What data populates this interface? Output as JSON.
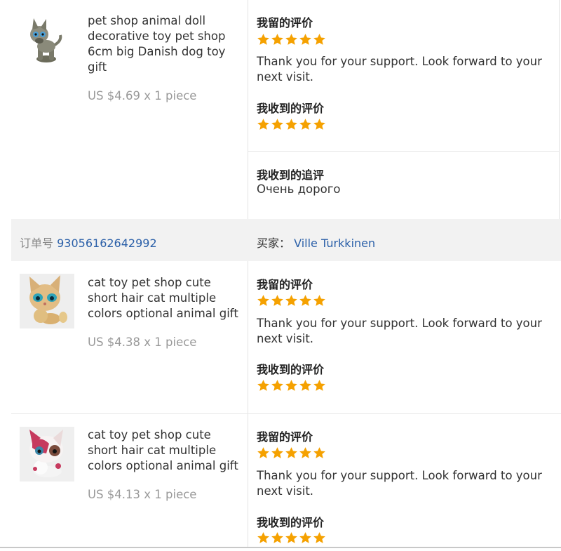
{
  "block1": {
    "title": "pet shop animal doll decorative toy pet shop 6cm big Danish dog toy gift",
    "price": "US $4.69 x 1 piece",
    "feedback_left_label": "我留的评价",
    "feedback_left_rating": 5,
    "feedback_left_message": "Thank you for your support. Look forward to your next visit.",
    "feedback_received_label": "我收到的评价",
    "feedback_received_rating": 5,
    "followup_label": "我收到的追评",
    "followup_text": "Очень дорого"
  },
  "order_bar": {
    "order_label": "订单号",
    "order_number": "93056162642992",
    "buyer_label": "买家：",
    "buyer_name": "Ville Turkkinen"
  },
  "block2": {
    "title": "cat toy pet shop cute short hair cat multiple colors optional animal gift",
    "price": "US $4.38 x 1 piece",
    "feedback_left_label": "我留的评价",
    "feedback_left_rating": 5,
    "feedback_left_message": "Thank you for your support. Look forward to your next visit.",
    "feedback_received_label": "我收到的评价",
    "feedback_received_rating": 5
  },
  "block3": {
    "title": "cat toy pet shop cute short hair cat multiple colors optional animal gift",
    "price": "US $4.13 x 1 piece",
    "feedback_left_label": "我留的评价",
    "feedback_left_rating": 5,
    "feedback_left_message": "Thank you for your support. Look forward to your next visit.",
    "feedback_received_label": "我收到的评价",
    "feedback_received_rating": 5
  },
  "colors": {
    "star": "#f5a100",
    "link": "#2a5fa8",
    "order_bar_bg": "#f2f2f2"
  },
  "icons": {
    "star": "star-icon"
  }
}
